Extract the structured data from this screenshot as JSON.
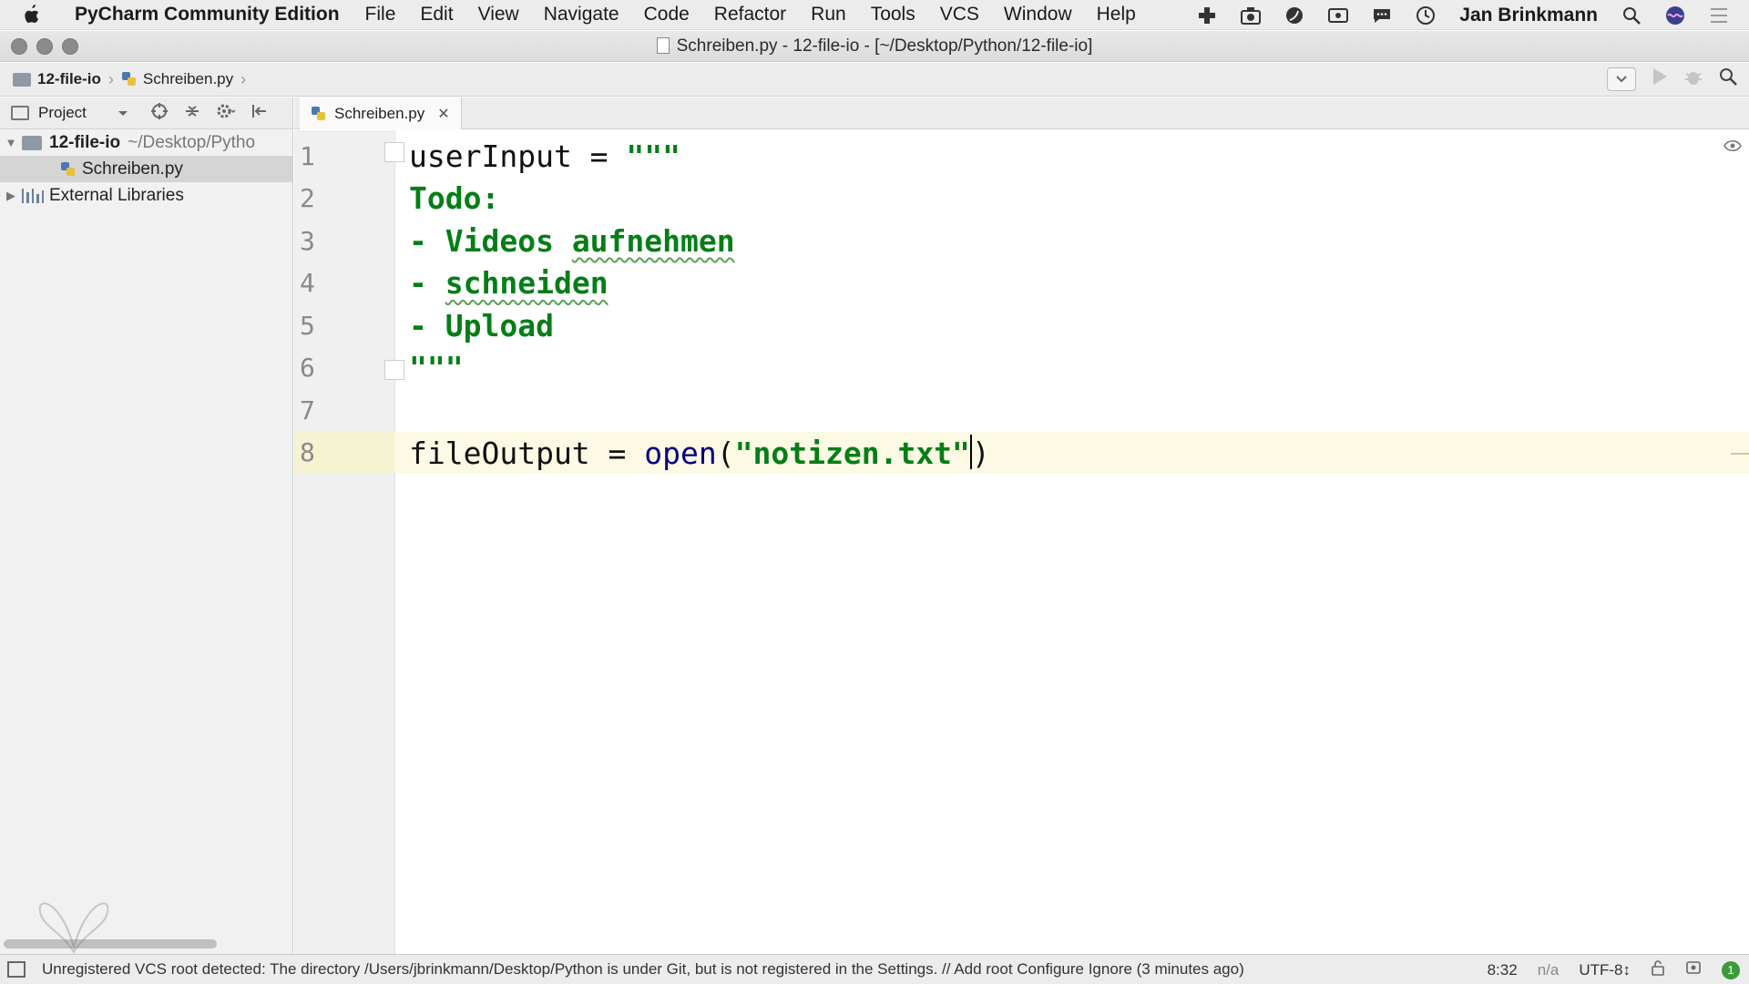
{
  "menubar": {
    "app_name": "PyCharm Community Edition",
    "items": [
      "File",
      "Edit",
      "View",
      "Navigate",
      "Code",
      "Refactor",
      "Run",
      "Tools",
      "VCS",
      "Window",
      "Help"
    ],
    "user": "Jan Brinkmann"
  },
  "window": {
    "title": "Schreiben.py - 12-file-io - [~/Desktop/Python/12-file-io]"
  },
  "breadcrumb": {
    "project": "12-file-io",
    "file": "Schreiben.py"
  },
  "project_panel": {
    "header": "Project",
    "root_name": "12-file-io",
    "root_path": "~/Desktop/Pytho",
    "file": "Schreiben.py",
    "libraries": "External Libraries"
  },
  "editor": {
    "tab_label": "Schreiben.py",
    "line_numbers": [
      "1",
      "2",
      "3",
      "4",
      "5",
      "6",
      "7",
      "8"
    ],
    "code": {
      "l1_ident": "userInput = ",
      "l1_str": "\"\"\"",
      "l2": "Todo:",
      "l3_dash": "- Videos ",
      "l3_word": "aufnehmen",
      "l4_dash": "- ",
      "l4_word": "schneiden",
      "l5": "- Upload",
      "l6": "\"\"\"",
      "l8_ident": "fileOutput = ",
      "l8_func": "open",
      "l8_open": "(",
      "l8_str": "\"notizen.txt\"",
      "l8_close": ")"
    }
  },
  "statusbar": {
    "message": "Unregistered VCS root detected: The directory /Users/jbrinkmann/Desktop/Python is under Git, but is not registered in the Settings. // Add root  Configure  Ignore (3 minutes ago)",
    "position": "8:32",
    "na": "n/a",
    "encoding": "UTF-8↕",
    "badge": "1"
  },
  "colors": {
    "string": "#067d17",
    "keyword": "#000080",
    "current_line": "#fcfae4"
  }
}
